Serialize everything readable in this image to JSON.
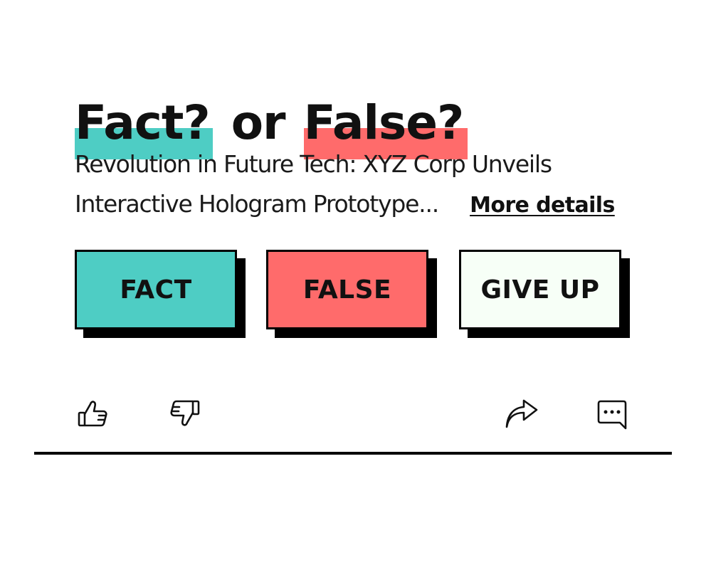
{
  "title": {
    "fact_word": "Fact?",
    "connector": "or",
    "false_word": "False?"
  },
  "headline": {
    "line1": "Revolution in Future Tech: XYZ Corp Unveils",
    "line2": "Interactive Hologram Prototype...",
    "more_link": "More details"
  },
  "buttons": {
    "fact": "FACT",
    "false": "FALSE",
    "give_up": "GIVE UP"
  },
  "actions": {
    "icons": [
      "thumbs-up-icon",
      "thumbs-down-icon",
      "share-icon",
      "comment-icon"
    ]
  },
  "colors": {
    "fact_teal": "#4ecdc4",
    "false_coral": "#ff6b6b",
    "give_up_bg": "#f7fff7",
    "ink": "#000000"
  }
}
